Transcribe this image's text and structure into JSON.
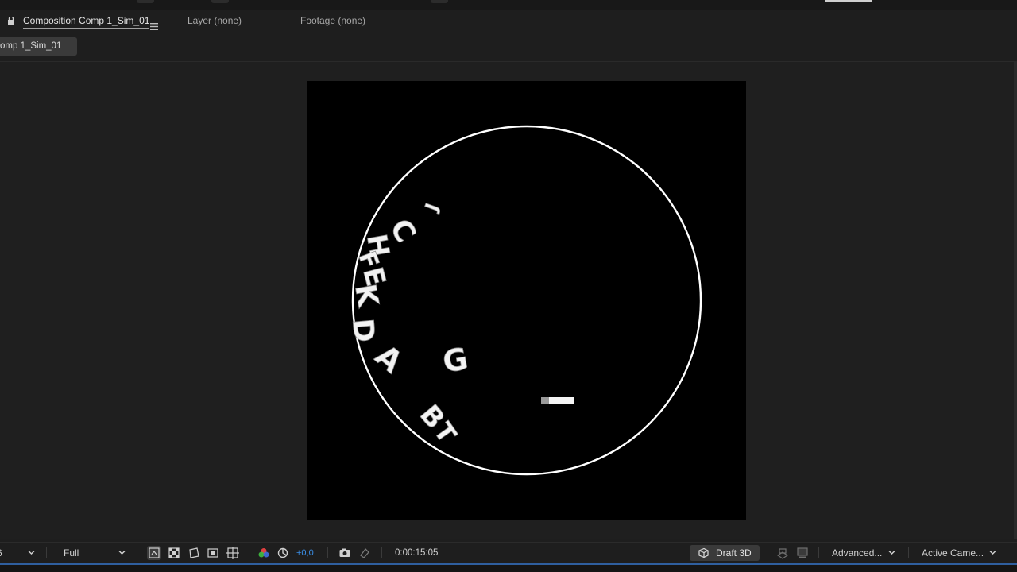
{
  "tabs": [
    {
      "label": "Composition Comp 1_Sim_01",
      "active": true
    },
    {
      "label": "Layer (none)",
      "active": false
    },
    {
      "label": "Footage (none)",
      "active": false
    }
  ],
  "flowchart": {
    "label": "omp 1_Sim_01"
  },
  "viewer": {
    "background": "#000000",
    "circle_color": "#ffffff",
    "letters": [
      "J",
      "C",
      "H",
      "F",
      "E",
      "K",
      "D",
      "A",
      "G",
      "B",
      "T",
      "I"
    ]
  },
  "toolbar": {
    "magnification_partial": "6",
    "resolution": "Full",
    "exposure": "+0,0",
    "timecode": "0:00:15:05",
    "renderer": "Draft 3D",
    "render_options": "Advanced...",
    "camera": "Active Came..."
  },
  "icons": {
    "lock": "lock-icon",
    "menu": "hamburger-menu-icon",
    "fast_preview": "fast-previews-icon",
    "transparency_grid": "transparency-grid-icon",
    "mask_visibility": "mask-path-visibility-icon",
    "region_of_interest": "region-of-interest-icon",
    "grid_guides": "grid-guides-icon",
    "channels": "color-channels-icon",
    "color_management": "color-management-icon",
    "snapshot": "snapshot-camera-icon",
    "show_snapshot": "show-snapshot-icon",
    "draft3d": "draft-3d-icon",
    "view_layout": "view-layout-icon",
    "view_layout2": "view-options-icon"
  }
}
